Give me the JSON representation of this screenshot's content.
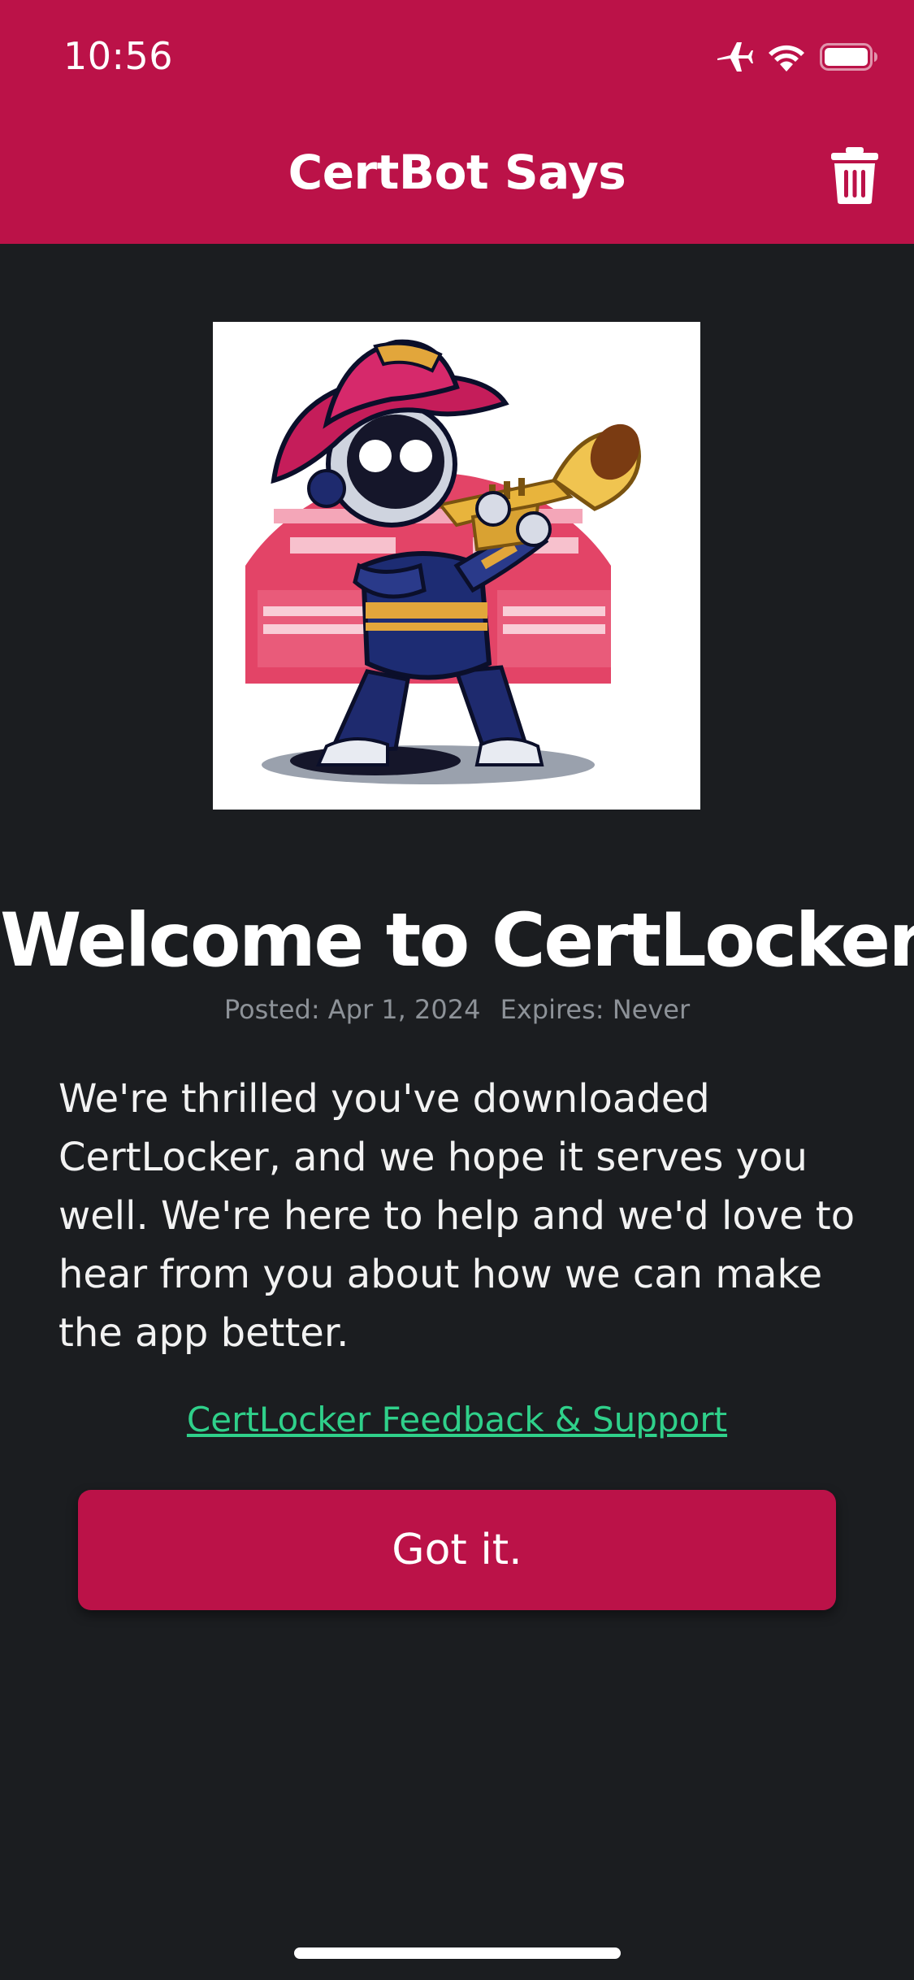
{
  "status_bar": {
    "time": "10:56",
    "icons": [
      "airplane-icon",
      "wifi-icon",
      "battery-icon"
    ]
  },
  "nav": {
    "title": "CertBot Says",
    "trash_icon": "trash-icon"
  },
  "message": {
    "image": "certbot-robot-trumpet-illustration",
    "title": "Welcome to CertLocker",
    "posted": "Posted: Apr 1, 2024",
    "expires": "Expires: Never",
    "body": "We're thrilled you've downloaded CertLocker, and we hope it serves you well. We're here to help and we'd love to hear from you about how we can make the app better.",
    "link": "CertLocker Feedback & Support",
    "button": "Got it."
  },
  "colors": {
    "brand": "#bb1248",
    "background": "#1b1d20",
    "link": "#2fd08a",
    "meta_text": "#8d9298"
  }
}
